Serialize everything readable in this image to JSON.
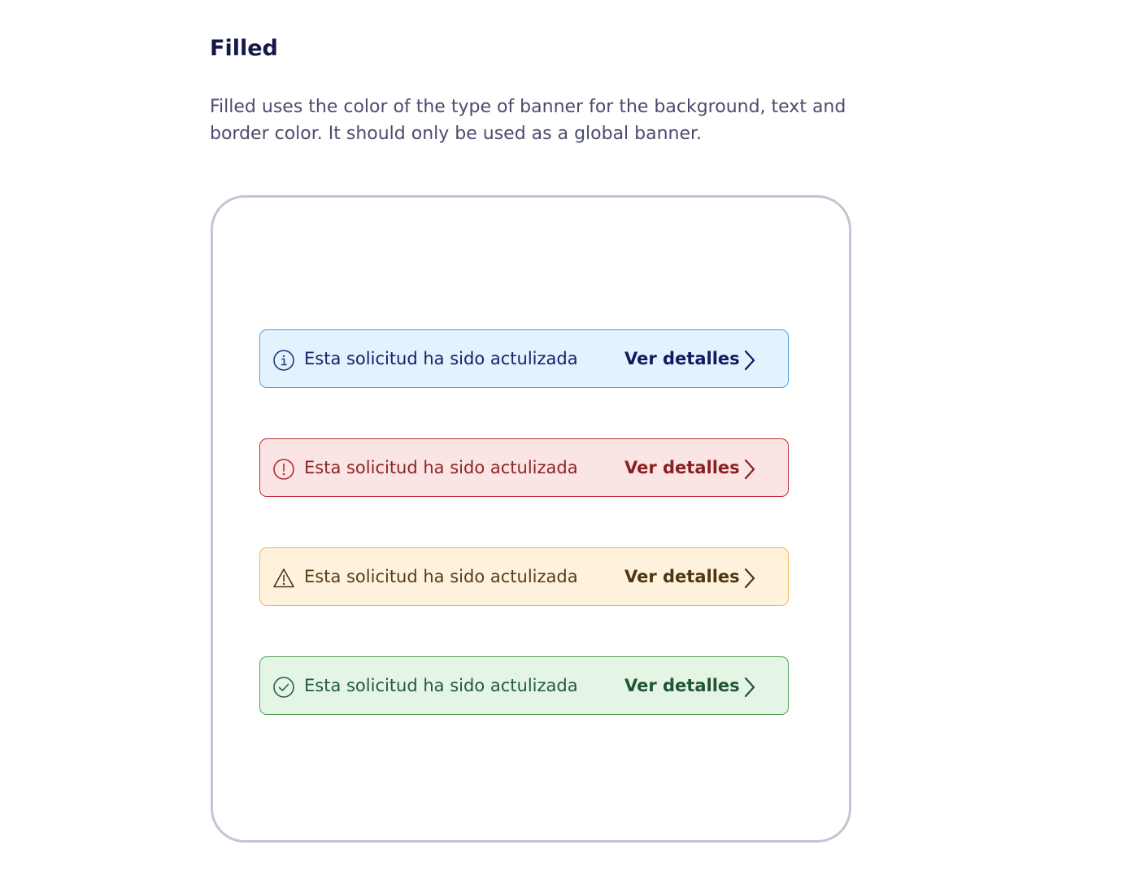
{
  "section": {
    "title": "Filled",
    "description": "Filled uses the color of the type of banner for the background, text and border color. It should only be used as a global banner."
  },
  "banners": [
    {
      "type": "info",
      "icon": "info-circle-icon",
      "message": "Esta solicitud ha sido actulizada",
      "action_label": "Ver detalles",
      "colors": {
        "background": "#e3f2fd",
        "border": "#4a9fe0",
        "text": "#16216b",
        "action": "#0f1a63",
        "icon": "#1f3a7a"
      }
    },
    {
      "type": "error",
      "icon": "exclamation-circle-icon",
      "message": "Esta solicitud ha sido actulizada",
      "action_label": "Ver detalles",
      "colors": {
        "background": "#fbe4e4",
        "border": "#c0303a",
        "text": "#8e2424",
        "action": "#8a1f1f",
        "icon": "#b02a2a"
      }
    },
    {
      "type": "warning",
      "icon": "warning-triangle-icon",
      "message": "Esta solicitud ha sido actulizada",
      "action_label": "Ver detalles",
      "colors": {
        "background": "#fff2dd",
        "border": "#f0bb55",
        "text": "#563c16",
        "action": "#4e3613",
        "icon": "#4a3514"
      }
    },
    {
      "type": "success",
      "icon": "check-circle-icon",
      "message": "Esta solicitud ha sido actulizada",
      "action_label": "Ver detalles",
      "colors": {
        "background": "#e4f5e6",
        "border": "#4f9f5a",
        "text": "#235b3a",
        "action": "#1f5533",
        "icon": "#2a5e3c"
      }
    }
  ]
}
